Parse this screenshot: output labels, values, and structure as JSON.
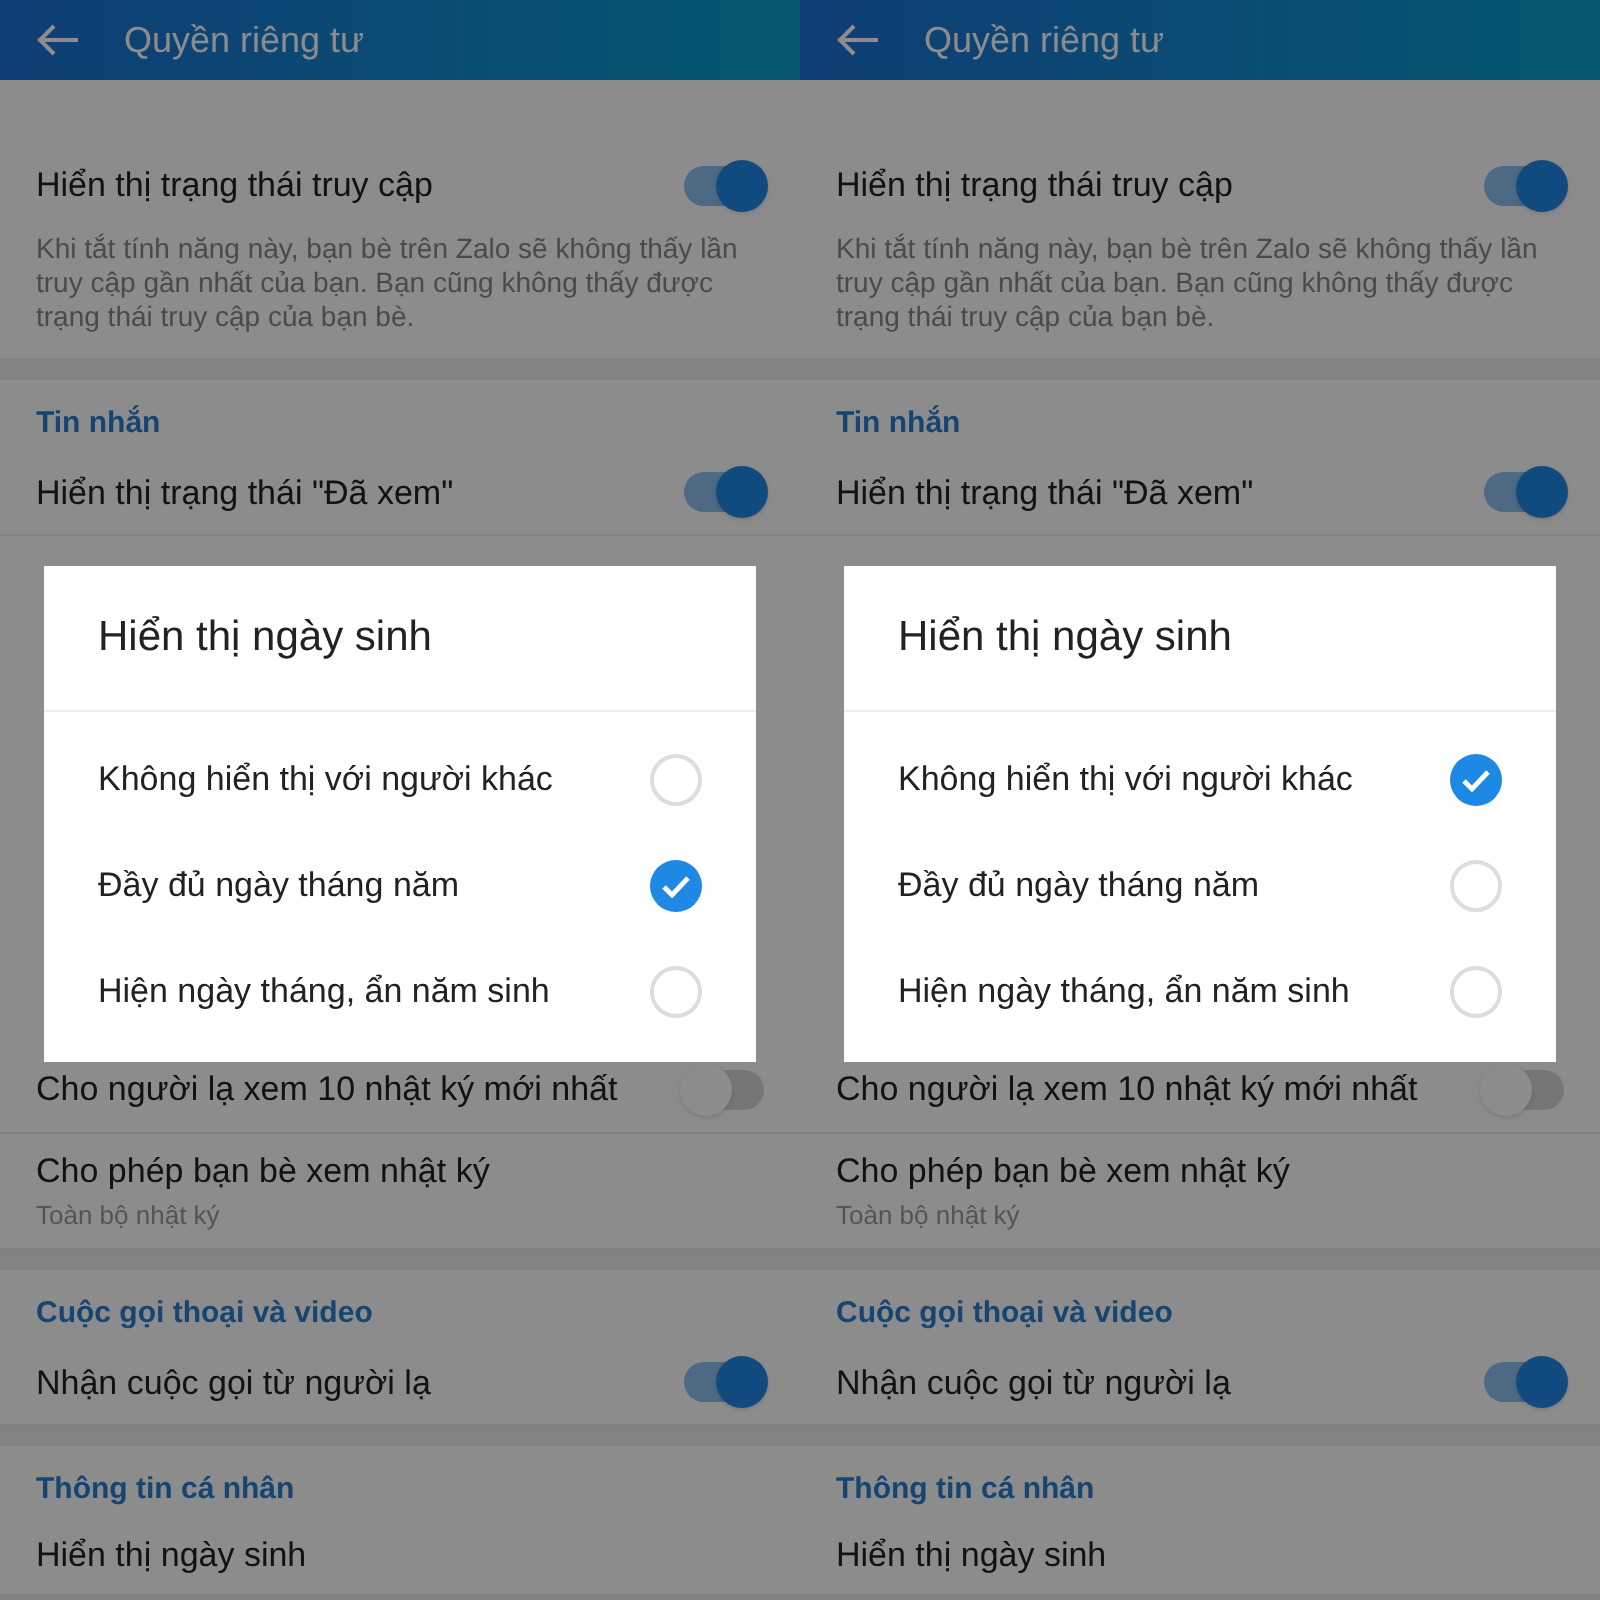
{
  "panels": [
    {
      "header": {
        "title": "Quyền riêng tư"
      },
      "groups": [
        {
          "items": [
            {
              "kind": "toggle",
              "label": "Hiển thị trạng thái truy cập",
              "on": true,
              "description": "Khi tắt tính năng này, bạn bè trên Zalo sẽ không thấy lần truy cập gần nhất của bạn. Bạn cũng không thấy được trạng thái truy cập của bạn bè."
            }
          ]
        },
        {
          "items": [
            {
              "kind": "section",
              "label": "Tin nhắn"
            },
            {
              "kind": "toggle",
              "label": "Hiển thị trạng thái \"Đã xem\"",
              "on": true
            }
          ]
        },
        {
          "items": [
            {
              "kind": "toggle",
              "label": "Cho người lạ xem 10 nhật ký mới nhất",
              "on": false
            },
            {
              "kind": "option",
              "label": "Cho phép bạn bè xem nhật ký",
              "value": "Toàn bộ nhật ký"
            }
          ]
        },
        {
          "items": [
            {
              "kind": "section",
              "label": "Cuộc gọi thoại và video"
            },
            {
              "kind": "toggle",
              "label": "Nhận cuộc gọi từ người lạ",
              "on": true
            }
          ]
        },
        {
          "items": [
            {
              "kind": "section",
              "label": "Thông tin cá nhân"
            },
            {
              "kind": "option",
              "label": "Hiển thị ngày sinh"
            }
          ]
        }
      ],
      "dialog": {
        "title": "Hiển thị ngày sinh",
        "options": [
          {
            "label": "Không hiển thị với người khác",
            "selected": false
          },
          {
            "label": "Đầy đủ ngày tháng năm",
            "selected": true
          },
          {
            "label": "Hiện ngày tháng, ẩn năm sinh",
            "selected": false
          }
        ]
      }
    },
    {
      "header": {
        "title": "Quyền riêng tư"
      },
      "groups": [
        {
          "items": [
            {
              "kind": "toggle",
              "label": "Hiển thị trạng thái truy cập",
              "on": true,
              "description": "Khi tắt tính năng này, bạn bè trên Zalo sẽ không thấy lần truy cập gần nhất của bạn. Bạn cũng không thấy được trạng thái truy cập của bạn bè."
            }
          ]
        },
        {
          "items": [
            {
              "kind": "section",
              "label": "Tin nhắn"
            },
            {
              "kind": "toggle",
              "label": "Hiển thị trạng thái \"Đã xem\"",
              "on": true
            }
          ]
        },
        {
          "items": [
            {
              "kind": "toggle",
              "label": "Cho người lạ xem 10 nhật ký mới nhất",
              "on": false
            },
            {
              "kind": "option",
              "label": "Cho phép bạn bè xem nhật ký",
              "value": "Toàn bộ nhật ký"
            }
          ]
        },
        {
          "items": [
            {
              "kind": "section",
              "label": "Cuộc gọi thoại và video"
            },
            {
              "kind": "toggle",
              "label": "Nhận cuộc gọi từ người lạ",
              "on": true
            }
          ]
        },
        {
          "items": [
            {
              "kind": "section",
              "label": "Thông tin cá nhân"
            },
            {
              "kind": "option",
              "label": "Hiển thị ngày sinh"
            }
          ]
        }
      ],
      "dialog": {
        "title": "Hiển thị ngày sinh",
        "options": [
          {
            "label": "Không hiển thị với người khác",
            "selected": true
          },
          {
            "label": "Đầy đủ ngày tháng năm",
            "selected": false
          },
          {
            "label": "Hiện ngày tháng, ẩn năm sinh",
            "selected": false
          }
        ]
      }
    }
  ]
}
